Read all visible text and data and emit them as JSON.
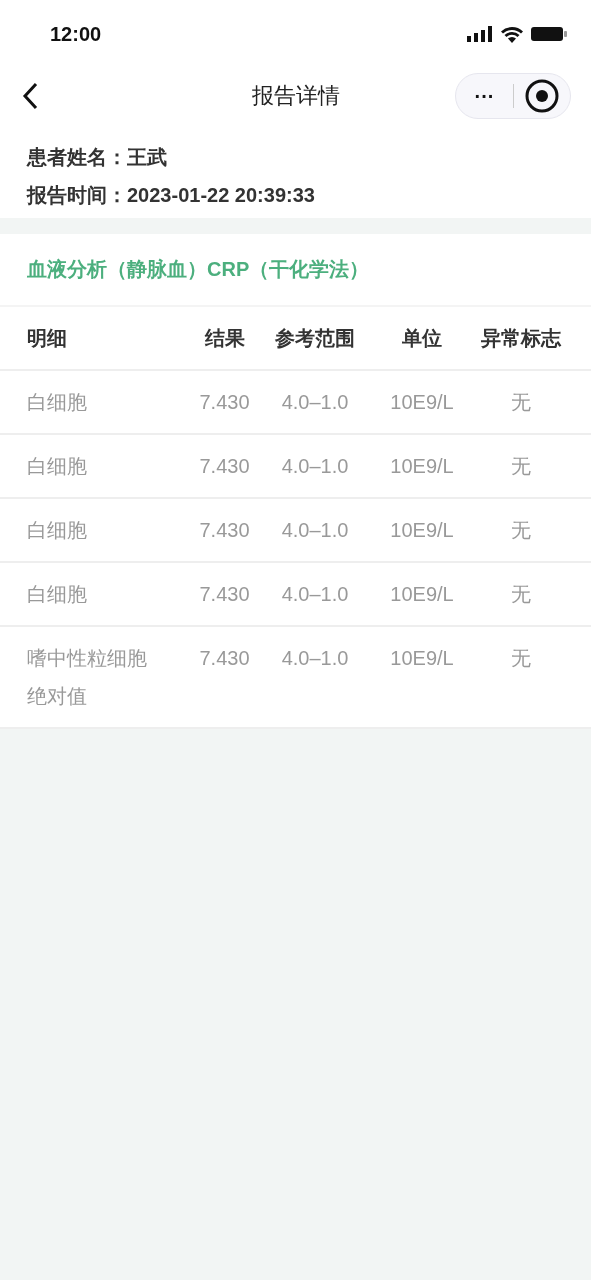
{
  "status_bar": {
    "time": "12:00"
  },
  "nav": {
    "title": "报告详情",
    "more": "···"
  },
  "patient": [
    {
      "label": "患者姓名：",
      "value": "王武"
    },
    {
      "label": "报告时间：",
      "value": "2023-01-22 20:39:33"
    }
  ],
  "section_title": "血液分析（静脉血）CRP（干化学法）",
  "table": {
    "columns": [
      "明细",
      "结果",
      "参考范围",
      "单位",
      "异常标志"
    ],
    "rows": [
      [
        "白细胞",
        "7.430",
        "4.0–1.0",
        "10E9/L",
        "无"
      ],
      [
        "白细胞",
        "7.430",
        "4.0–1.0",
        "10E9/L",
        "无"
      ],
      [
        "白细胞",
        "7.430",
        "4.0–1.0",
        "10E9/L",
        "无"
      ],
      [
        "白细胞",
        "7.430",
        "4.0–1.0",
        "10E9/L",
        "无"
      ],
      [
        "嗜中性粒细胞绝对值",
        "7.430",
        "4.0–1.0",
        "10E9/L",
        "无"
      ]
    ]
  }
}
